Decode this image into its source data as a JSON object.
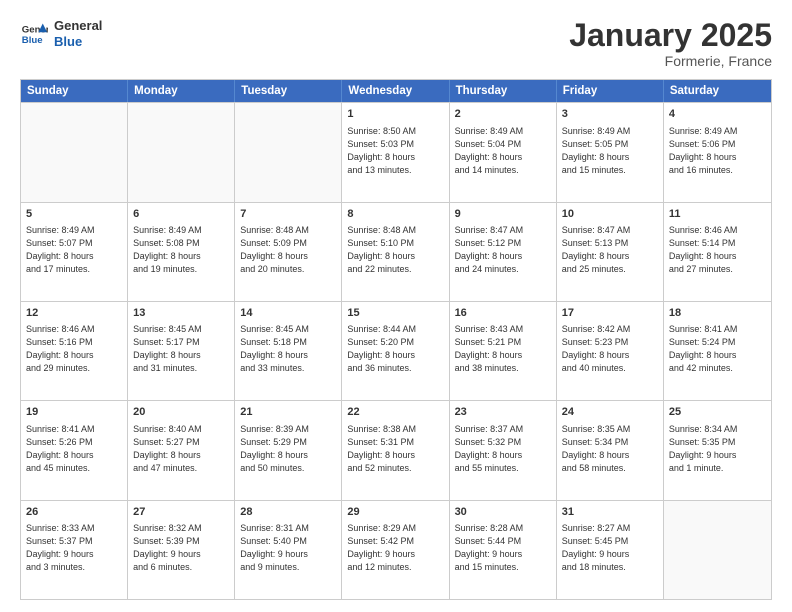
{
  "logo": {
    "line1": "General",
    "line2": "Blue"
  },
  "title": "January 2025",
  "subtitle": "Formerie, France",
  "header_days": [
    "Sunday",
    "Monday",
    "Tuesday",
    "Wednesday",
    "Thursday",
    "Friday",
    "Saturday"
  ],
  "rows": [
    [
      {
        "day": "",
        "text": ""
      },
      {
        "day": "",
        "text": ""
      },
      {
        "day": "",
        "text": ""
      },
      {
        "day": "1",
        "text": "Sunrise: 8:50 AM\nSunset: 5:03 PM\nDaylight: 8 hours\nand 13 minutes."
      },
      {
        "day": "2",
        "text": "Sunrise: 8:49 AM\nSunset: 5:04 PM\nDaylight: 8 hours\nand 14 minutes."
      },
      {
        "day": "3",
        "text": "Sunrise: 8:49 AM\nSunset: 5:05 PM\nDaylight: 8 hours\nand 15 minutes."
      },
      {
        "day": "4",
        "text": "Sunrise: 8:49 AM\nSunset: 5:06 PM\nDaylight: 8 hours\nand 16 minutes."
      }
    ],
    [
      {
        "day": "5",
        "text": "Sunrise: 8:49 AM\nSunset: 5:07 PM\nDaylight: 8 hours\nand 17 minutes."
      },
      {
        "day": "6",
        "text": "Sunrise: 8:49 AM\nSunset: 5:08 PM\nDaylight: 8 hours\nand 19 minutes."
      },
      {
        "day": "7",
        "text": "Sunrise: 8:48 AM\nSunset: 5:09 PM\nDaylight: 8 hours\nand 20 minutes."
      },
      {
        "day": "8",
        "text": "Sunrise: 8:48 AM\nSunset: 5:10 PM\nDaylight: 8 hours\nand 22 minutes."
      },
      {
        "day": "9",
        "text": "Sunrise: 8:47 AM\nSunset: 5:12 PM\nDaylight: 8 hours\nand 24 minutes."
      },
      {
        "day": "10",
        "text": "Sunrise: 8:47 AM\nSunset: 5:13 PM\nDaylight: 8 hours\nand 25 minutes."
      },
      {
        "day": "11",
        "text": "Sunrise: 8:46 AM\nSunset: 5:14 PM\nDaylight: 8 hours\nand 27 minutes."
      }
    ],
    [
      {
        "day": "12",
        "text": "Sunrise: 8:46 AM\nSunset: 5:16 PM\nDaylight: 8 hours\nand 29 minutes."
      },
      {
        "day": "13",
        "text": "Sunrise: 8:45 AM\nSunset: 5:17 PM\nDaylight: 8 hours\nand 31 minutes."
      },
      {
        "day": "14",
        "text": "Sunrise: 8:45 AM\nSunset: 5:18 PM\nDaylight: 8 hours\nand 33 minutes."
      },
      {
        "day": "15",
        "text": "Sunrise: 8:44 AM\nSunset: 5:20 PM\nDaylight: 8 hours\nand 36 minutes."
      },
      {
        "day": "16",
        "text": "Sunrise: 8:43 AM\nSunset: 5:21 PM\nDaylight: 8 hours\nand 38 minutes."
      },
      {
        "day": "17",
        "text": "Sunrise: 8:42 AM\nSunset: 5:23 PM\nDaylight: 8 hours\nand 40 minutes."
      },
      {
        "day": "18",
        "text": "Sunrise: 8:41 AM\nSunset: 5:24 PM\nDaylight: 8 hours\nand 42 minutes."
      }
    ],
    [
      {
        "day": "19",
        "text": "Sunrise: 8:41 AM\nSunset: 5:26 PM\nDaylight: 8 hours\nand 45 minutes."
      },
      {
        "day": "20",
        "text": "Sunrise: 8:40 AM\nSunset: 5:27 PM\nDaylight: 8 hours\nand 47 minutes."
      },
      {
        "day": "21",
        "text": "Sunrise: 8:39 AM\nSunset: 5:29 PM\nDaylight: 8 hours\nand 50 minutes."
      },
      {
        "day": "22",
        "text": "Sunrise: 8:38 AM\nSunset: 5:31 PM\nDaylight: 8 hours\nand 52 minutes."
      },
      {
        "day": "23",
        "text": "Sunrise: 8:37 AM\nSunset: 5:32 PM\nDaylight: 8 hours\nand 55 minutes."
      },
      {
        "day": "24",
        "text": "Sunrise: 8:35 AM\nSunset: 5:34 PM\nDaylight: 8 hours\nand 58 minutes."
      },
      {
        "day": "25",
        "text": "Sunrise: 8:34 AM\nSunset: 5:35 PM\nDaylight: 9 hours\nand 1 minute."
      }
    ],
    [
      {
        "day": "26",
        "text": "Sunrise: 8:33 AM\nSunset: 5:37 PM\nDaylight: 9 hours\nand 3 minutes."
      },
      {
        "day": "27",
        "text": "Sunrise: 8:32 AM\nSunset: 5:39 PM\nDaylight: 9 hours\nand 6 minutes."
      },
      {
        "day": "28",
        "text": "Sunrise: 8:31 AM\nSunset: 5:40 PM\nDaylight: 9 hours\nand 9 minutes."
      },
      {
        "day": "29",
        "text": "Sunrise: 8:29 AM\nSunset: 5:42 PM\nDaylight: 9 hours\nand 12 minutes."
      },
      {
        "day": "30",
        "text": "Sunrise: 8:28 AM\nSunset: 5:44 PM\nDaylight: 9 hours\nand 15 minutes."
      },
      {
        "day": "31",
        "text": "Sunrise: 8:27 AM\nSunset: 5:45 PM\nDaylight: 9 hours\nand 18 minutes."
      },
      {
        "day": "",
        "text": ""
      }
    ]
  ]
}
